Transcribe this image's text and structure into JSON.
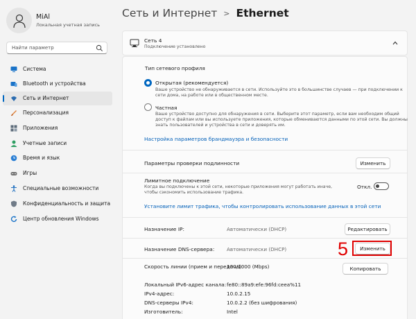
{
  "user": {
    "name": "MiAl",
    "account_type": "Локальная учетная запись"
  },
  "search": {
    "placeholder": "Найти параметр"
  },
  "sidebar": {
    "items": [
      {
        "label": "Система",
        "icon": "monitor-icon",
        "color": "#1a73c8"
      },
      {
        "label": "Bluetooth и устройства",
        "icon": "bluetooth-icon",
        "color": "#1a73c8"
      },
      {
        "label": "Сеть и Интернет",
        "icon": "wifi-icon",
        "color": "#2b6cb0",
        "active": true
      },
      {
        "label": "Персонализация",
        "icon": "brush-icon",
        "color": "#e0823a"
      },
      {
        "label": "Приложения",
        "icon": "apps-icon",
        "color": "#5c6b7a"
      },
      {
        "label": "Учетные записи",
        "icon": "person-icon",
        "color": "#2e9e62"
      },
      {
        "label": "Время и язык",
        "icon": "globe-clock-icon",
        "color": "#2b7fd4"
      },
      {
        "label": "Игры",
        "icon": "gamepad-icon",
        "color": "#707070"
      },
      {
        "label": "Специальные возможности",
        "icon": "accessibility-icon",
        "color": "#1f6fbf"
      },
      {
        "label": "Конфиденциальность и защита",
        "icon": "shield-icon",
        "color": "#707b88"
      },
      {
        "label": "Центр обновления Windows",
        "icon": "update-icon",
        "color": "#1a73c8"
      }
    ]
  },
  "breadcrumb": {
    "parent": "Сеть и Интернет",
    "separator": ">",
    "current": "Ethernet"
  },
  "network": {
    "name": "Сеть 4",
    "status": "Подключение установлено"
  },
  "profile": {
    "heading": "Тип сетевого профиля",
    "open_label": "Открытая (рекомендуется)",
    "open_desc_1": "Ваше устройство не обнаруживается в сети. Используйте это в большинстве случаев — при подключении к",
    "open_desc_2": "сети дома, на работе или в общественном месте.",
    "private_label": "Частная",
    "private_desc_1": "Ваше устройство доступно для обнаружения в сети. Выберите этот параметр, если вам необходим общий",
    "private_desc_2": "доступ к файлам или вы используете приложения, которые обмениваются данными по этой сети. Вы должны",
    "private_desc_3": "знать пользователей и устройства в сети и доверять им.",
    "firewall_link": "Настройка параметров брандмауэра и безопасности"
  },
  "auth": {
    "label": "Параметры проверки подлинности",
    "button": "Изменить"
  },
  "metered": {
    "label": "Лимитное подключение",
    "desc_1": "Когда вы подключены к этой сети, некоторые приложения могут работать иначе,",
    "desc_2": "чтобы сэкономить использование трафика.",
    "state": "Откл.",
    "link": "Установите лимит трафика, чтобы контролировать использование данных в этой сети"
  },
  "ip": {
    "label": "Назначение IP:",
    "value": "Автоматически (DHCP)",
    "button": "Редактировать"
  },
  "dns": {
    "label": "Назначение DNS-сервера:",
    "value": "Автоматически (DHCP)",
    "button": "Изменить"
  },
  "properties": {
    "copy_button": "Копировать",
    "rows": [
      {
        "label": "Скорость линии (прием и передача):",
        "value": "100/1000 (Mbps)"
      },
      {
        "label": "Локальный IPv6-адрес канала:",
        "value": "fe80::89a9:efe:96fd:ceea%11"
      },
      {
        "label": "IPv4-адрес:",
        "value": "10.0.2.15"
      },
      {
        "label": "DNS-серверы IPv4:",
        "value": "10.0.2.2 (без шифрования)"
      },
      {
        "label": "Изготовитель:",
        "value": "Intel"
      }
    ]
  },
  "annotation": {
    "number": "5",
    "color": "#e00000"
  },
  "colors": {
    "accent": "#0067c0",
    "link": "#005fb8"
  }
}
